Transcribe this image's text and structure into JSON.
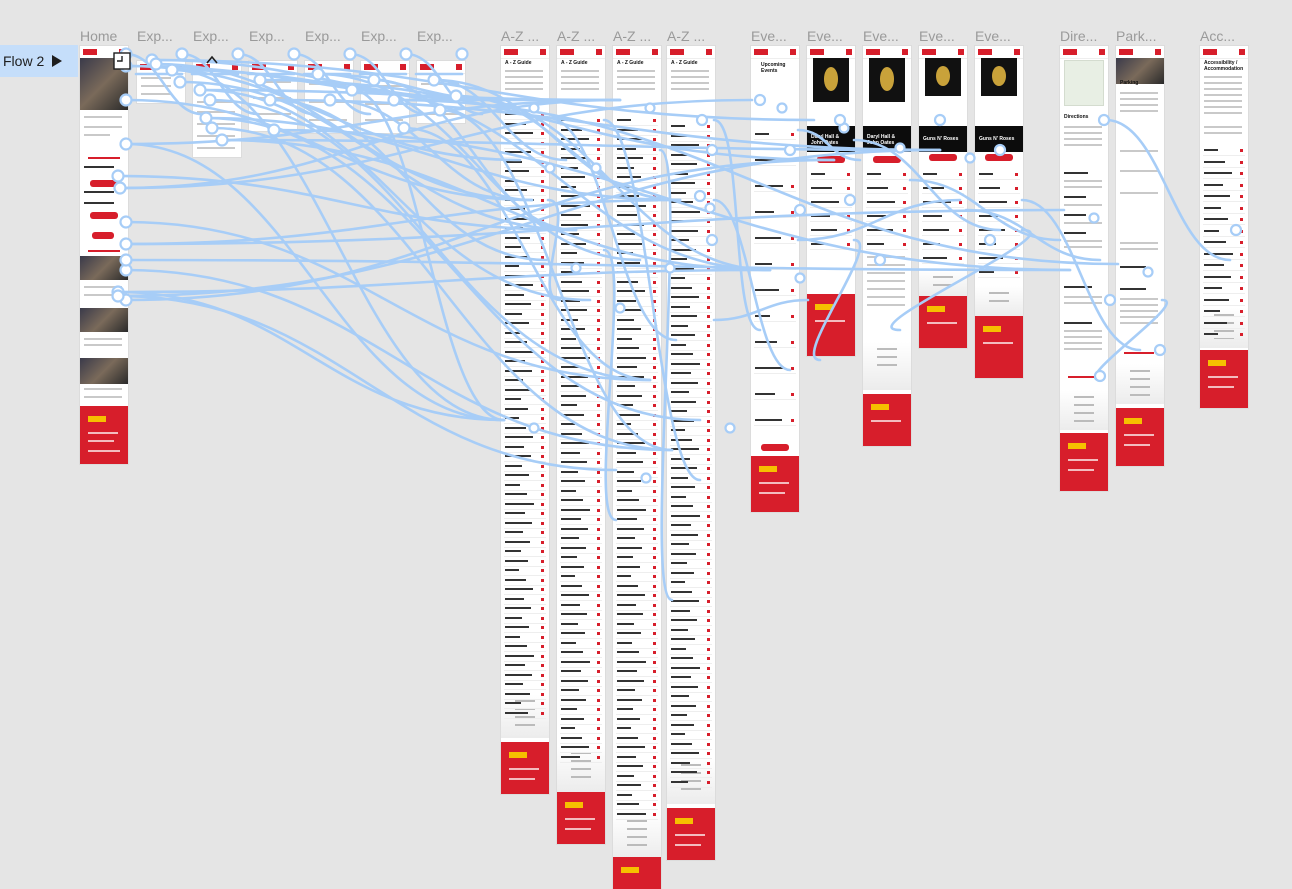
{
  "canvas": {
    "background": "#e5e5e5",
    "wire_color": "#a7cdf7",
    "accent": "#d71e2b"
  },
  "flow": {
    "label": "Flow 2",
    "icon": "play-icon"
  },
  "frames": [
    {
      "title": "Home",
      "heading": "",
      "kind": "home"
    },
    {
      "title": "Exp...",
      "heading": "",
      "kind": "explore"
    },
    {
      "title": "Exp...",
      "heading": "",
      "kind": "explore"
    },
    {
      "title": "Exp...",
      "heading": "",
      "kind": "explore"
    },
    {
      "title": "Exp...",
      "heading": "",
      "kind": "explore"
    },
    {
      "title": "Exp...",
      "heading": "",
      "kind": "explore"
    },
    {
      "title": "Exp...",
      "heading": "",
      "kind": "explore"
    },
    {
      "title": "A-Z ...",
      "heading": "A - Z Guide",
      "kind": "az"
    },
    {
      "title": "A-Z ...",
      "heading": "A - Z Guide",
      "kind": "az"
    },
    {
      "title": "A-Z ...",
      "heading": "A - Z Guide",
      "kind": "az"
    },
    {
      "title": "A-Z ...",
      "heading": "A - Z Guide",
      "kind": "az"
    },
    {
      "title": "Eve...",
      "heading": "Upcoming Events",
      "kind": "events"
    },
    {
      "title": "Eve...",
      "heading": "Daryl Hall & John Oates",
      "kind": "event"
    },
    {
      "title": "Eve...",
      "heading": "Daryl Hall & John Oates",
      "kind": "event"
    },
    {
      "title": "Eve...",
      "heading": "Guns N' Roses",
      "kind": "event"
    },
    {
      "title": "Eve...",
      "heading": "Guns N' Roses",
      "kind": "event"
    },
    {
      "title": "Dire...",
      "heading": "Directions",
      "kind": "directions"
    },
    {
      "title": "Park...",
      "heading": "Parking",
      "kind": "parking"
    },
    {
      "title": "Acc...",
      "heading": "Accessibility / Accommodation",
      "kind": "access"
    }
  ]
}
